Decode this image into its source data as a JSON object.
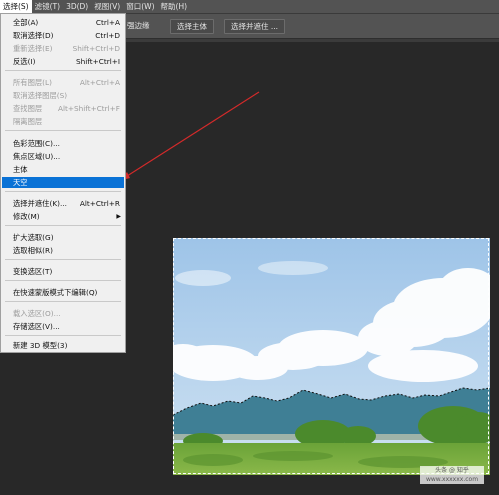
{
  "menubar": {
    "items": [
      {
        "label": "选择(S)",
        "active": true
      },
      {
        "label": "滤镜(T)",
        "active": false
      },
      {
        "label": "3D(D)",
        "active": false
      },
      {
        "label": "视图(V)",
        "active": false
      },
      {
        "label": "窗口(W)",
        "active": false
      },
      {
        "label": "帮助(H)",
        "active": false
      }
    ]
  },
  "optbar": {
    "fragment": "强边缘",
    "buttons": [
      "选择主体",
      "选择并遮住 ..."
    ]
  },
  "menu": {
    "items": [
      {
        "label": "全部(A)",
        "shortcut": "Ctrl+A",
        "disabled": false
      },
      {
        "label": "取消选择(D)",
        "shortcut": "Ctrl+D",
        "disabled": false
      },
      {
        "label": "重新选择(E)",
        "shortcut": "Shift+Ctrl+D",
        "disabled": true
      },
      {
        "label": "反选(I)",
        "shortcut": "Shift+Ctrl+I",
        "disabled": false
      },
      {
        "label": "所有图层(L)",
        "shortcut": "Alt+Ctrl+A",
        "disabled": true
      },
      {
        "label": "取消选择图层(S)",
        "shortcut": "",
        "disabled": true
      },
      {
        "label": "查找图层",
        "shortcut": "Alt+Shift+Ctrl+F",
        "disabled": true
      },
      {
        "label": "隔离图层",
        "shortcut": "",
        "disabled": true
      },
      {
        "label": "色彩范围(C)...",
        "shortcut": "",
        "disabled": false
      },
      {
        "label": "焦点区域(U)...",
        "shortcut": "",
        "disabled": false
      },
      {
        "label": "主体",
        "shortcut": "",
        "disabled": false
      },
      {
        "label": "天空",
        "shortcut": "",
        "disabled": false,
        "highlighted": true
      },
      {
        "label": "选择并遮住(K)...",
        "shortcut": "Alt+Ctrl+R",
        "disabled": false
      },
      {
        "label": "修改(M)",
        "shortcut": "",
        "disabled": false,
        "submenu": true
      },
      {
        "label": "扩大选取(G)",
        "shortcut": "",
        "disabled": false
      },
      {
        "label": "选取相似(R)",
        "shortcut": "",
        "disabled": false
      },
      {
        "label": "变换选区(T)",
        "shortcut": "",
        "disabled": false
      },
      {
        "label": "在快速蒙版模式下编辑(Q)",
        "shortcut": "",
        "disabled": false
      },
      {
        "label": "载入选区(O)...",
        "shortcut": "",
        "disabled": true
      },
      {
        "label": "存储选区(V)...",
        "shortcut": "",
        "disabled": false
      },
      {
        "label": "新建 3D 模型(3)",
        "shortcut": "",
        "disabled": false
      }
    ],
    "submenu_arrow": "▶"
  },
  "colors": {
    "highlight": "#0a72d6",
    "annotation_arrow": "#d42a2a",
    "sky_top": "#9ec4e8",
    "sky_bottom": "#cfe2f2",
    "mountain": "#3f7f95",
    "grass": "#78a83e"
  },
  "watermark": {
    "line1": "头条 @ 知乎",
    "line2": "www.xxxxxx.com"
  }
}
